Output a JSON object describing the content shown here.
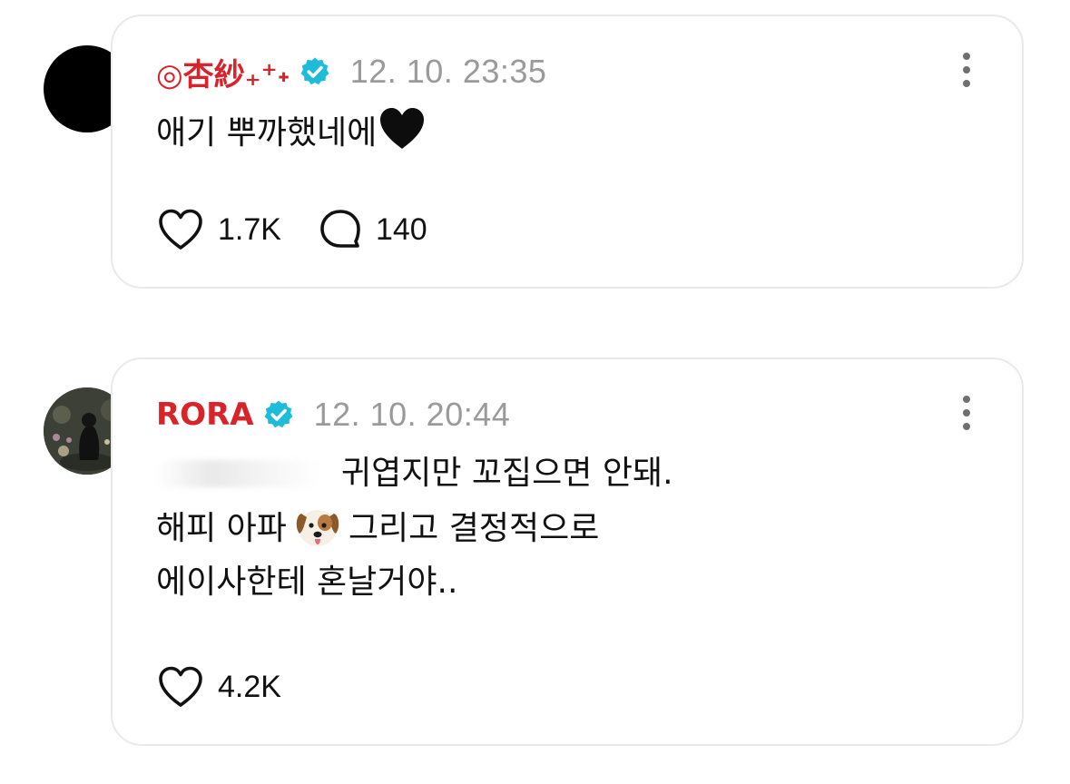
{
  "comments": [
    {
      "username": "◎杏紗₊⁺˖",
      "verified": true,
      "timestamp": "12. 10. 23:35",
      "text_lines": [
        "애기 뿌까했네에"
      ],
      "text_emoji": "black-heart",
      "likes": "1.7K",
      "replies": "140",
      "avatar": "black-circle"
    },
    {
      "username": "RORA",
      "verified": true,
      "timestamp": "12. 10. 20:44",
      "text_lines": [
        "귀엽지만 꼬집으면 안돼.",
        "해피 아파",
        "그리고 결정적으로",
        "에이사한테 혼날거야.."
      ],
      "text_emoji": "dog-face",
      "likes": "4.2K",
      "avatar": "photo-thumbnail"
    }
  ],
  "colors": {
    "username": "#d8232a",
    "verified_badge": "#1ebcd8",
    "timestamp": "#9a9a9a",
    "card_border": "#e9e9e9"
  },
  "icons": {
    "like": "heart-outline-icon",
    "reply": "speech-bubble-icon",
    "more": "more-vertical-icon",
    "verified": "verified-badge-icon"
  }
}
